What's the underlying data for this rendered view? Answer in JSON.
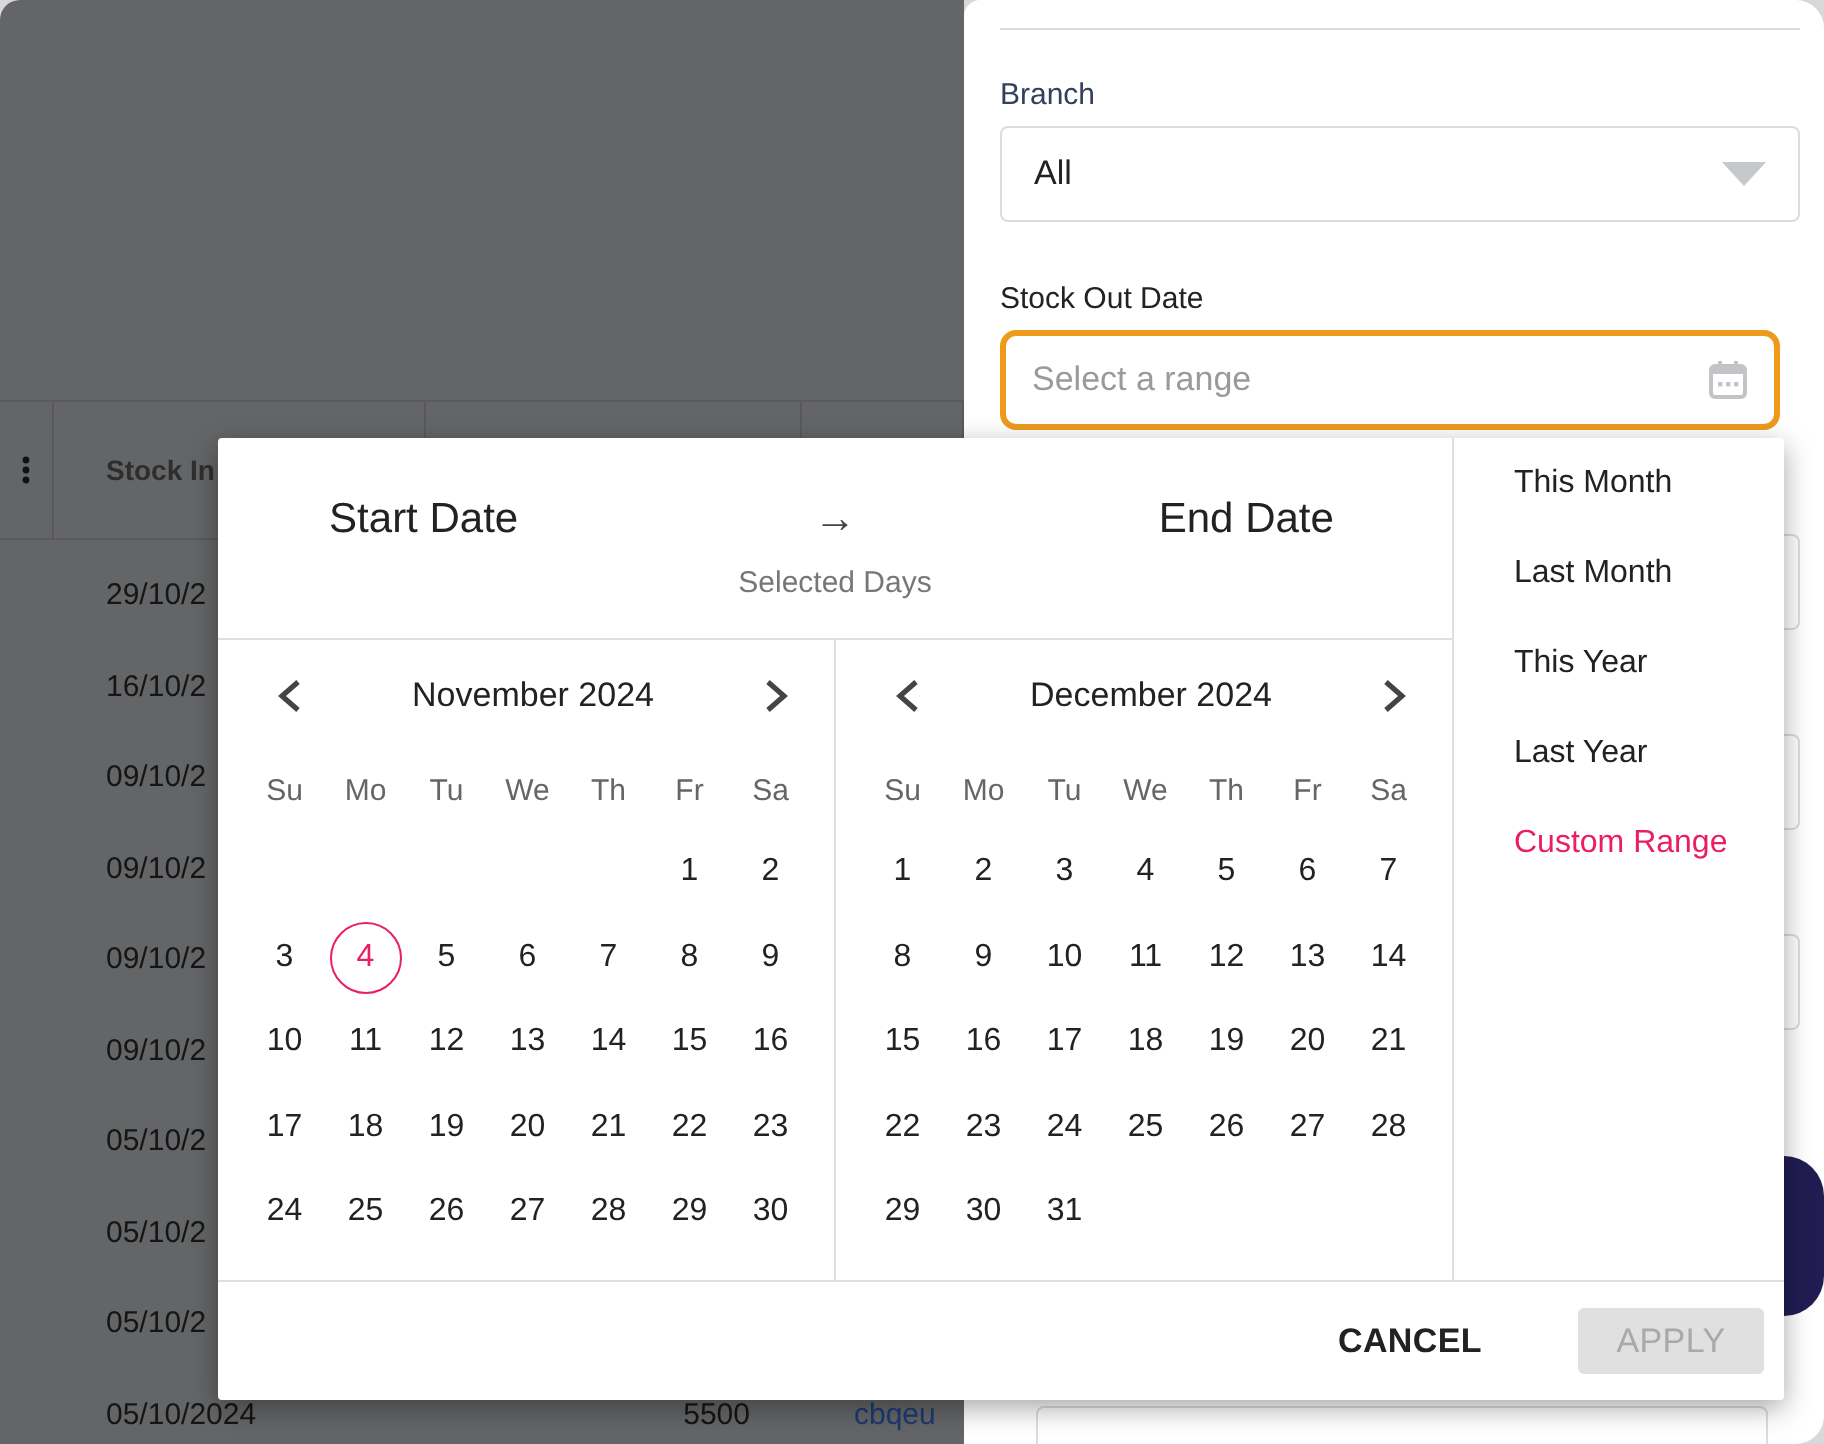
{
  "table": {
    "columns": [
      "Stock In"
    ],
    "rows": [
      {
        "cells": [
          "29/10/2"
        ]
      },
      {
        "cells": [
          "16/10/2"
        ]
      },
      {
        "cells": [
          "09/10/2"
        ]
      },
      {
        "cells": [
          "09/10/2"
        ]
      },
      {
        "cells": [
          "09/10/2"
        ]
      },
      {
        "cells": [
          "09/10/2"
        ]
      },
      {
        "cells": [
          "05/10/2"
        ]
      },
      {
        "cells": [
          "05/10/2"
        ]
      },
      {
        "cells": [
          "05/10/2"
        ]
      },
      {
        "cells": [
          "05/10/2024",
          "5500",
          "cbqeu"
        ]
      }
    ]
  },
  "filter_panel": {
    "fields": [
      {
        "kind": "select",
        "label": "Branch",
        "value": "All"
      },
      {
        "kind": "date",
        "label": "Stock Out Date",
        "placeholder": "Select a range",
        "focused": true
      }
    ]
  },
  "date_picker": {
    "start_label": "Start Date",
    "arrow": "→",
    "end_label": "End Date",
    "subtitle": "Selected Days",
    "months": [
      {
        "title": "November 2024",
        "weekdays": [
          "Su",
          "Mo",
          "Tu",
          "We",
          "Th",
          "Fr",
          "Sa"
        ],
        "weeks": [
          [
            {
              "day": "1",
              "today": false
            },
            {
              "day": "2",
              "today": false
            }
          ],
          [
            {
              "day": "3",
              "today": false
            },
            {
              "day": "4",
              "today": true
            },
            {
              "day": "5",
              "today": false
            },
            {
              "day": "6",
              "today": false
            },
            {
              "day": "7",
              "today": false
            },
            {
              "day": "8",
              "today": false
            },
            {
              "day": "9",
              "today": false
            }
          ],
          [
            {
              "day": "10",
              "today": false
            },
            {
              "day": "11",
              "today": false
            },
            {
              "day": "12",
              "today": false
            },
            {
              "day": "13",
              "today": false
            },
            {
              "day": "14",
              "today": false
            },
            {
              "day": "15",
              "today": false
            },
            {
              "day": "16",
              "today": false
            }
          ],
          [
            {
              "day": "17",
              "today": false
            },
            {
              "day": "18",
              "today": false
            },
            {
              "day": "19",
              "today": false
            },
            {
              "day": "20",
              "today": false
            },
            {
              "day": "21",
              "today": false
            },
            {
              "day": "22",
              "today": false
            },
            {
              "day": "23",
              "today": false
            }
          ],
          [
            {
              "day": "24",
              "today": false
            },
            {
              "day": "25",
              "today": false
            },
            {
              "day": "26",
              "today": false
            },
            {
              "day": "27",
              "today": false
            },
            {
              "day": "28",
              "today": false
            },
            {
              "day": "29",
              "today": false
            },
            {
              "day": "30",
              "today": false
            }
          ]
        ]
      },
      {
        "title": "December 2024",
        "weekdays": [
          "Su",
          "Mo",
          "Tu",
          "We",
          "Th",
          "Fr",
          "Sa"
        ],
        "weeks": [
          [
            {
              "day": "1",
              "today": false
            },
            {
              "day": "2",
              "today": false
            },
            {
              "day": "3",
              "today": false
            },
            {
              "day": "4",
              "today": false
            },
            {
              "day": "5",
              "today": false
            },
            {
              "day": "6",
              "today": false
            },
            {
              "day": "7",
              "today": false
            }
          ],
          [
            {
              "day": "8",
              "today": false
            },
            {
              "day": "9",
              "today": false
            },
            {
              "day": "10",
              "today": false
            },
            {
              "day": "11",
              "today": false
            },
            {
              "day": "12",
              "today": false
            },
            {
              "day": "13",
              "today": false
            },
            {
              "day": "14",
              "today": false
            }
          ],
          [
            {
              "day": "15",
              "today": false
            },
            {
              "day": "16",
              "today": false
            },
            {
              "day": "17",
              "today": false
            },
            {
              "day": "18",
              "today": false
            },
            {
              "day": "19",
              "today": false
            },
            {
              "day": "20",
              "today": false
            },
            {
              "day": "21",
              "today": false
            }
          ],
          [
            {
              "day": "22",
              "today": false
            },
            {
              "day": "23",
              "today": false
            },
            {
              "day": "24",
              "today": false
            },
            {
              "day": "25",
              "today": false
            },
            {
              "day": "26",
              "today": false
            },
            {
              "day": "27",
              "today": false
            },
            {
              "day": "28",
              "today": false
            }
          ],
          [
            {
              "day": "29",
              "today": false
            },
            {
              "day": "30",
              "today": false
            },
            {
              "day": "31",
              "today": false
            }
          ]
        ]
      }
    ],
    "presets": [
      {
        "label": "This Month",
        "selected": false
      },
      {
        "label": "Last Month",
        "selected": false
      },
      {
        "label": "This Year",
        "selected": false
      },
      {
        "label": "Last Year",
        "selected": false
      },
      {
        "label": "Custom Range",
        "selected": true
      }
    ],
    "buttons": [
      {
        "kind": "text",
        "label": "CANCEL",
        "disabled": false
      },
      {
        "kind": "filled",
        "label": "APPLY",
        "disabled": true
      }
    ]
  }
}
